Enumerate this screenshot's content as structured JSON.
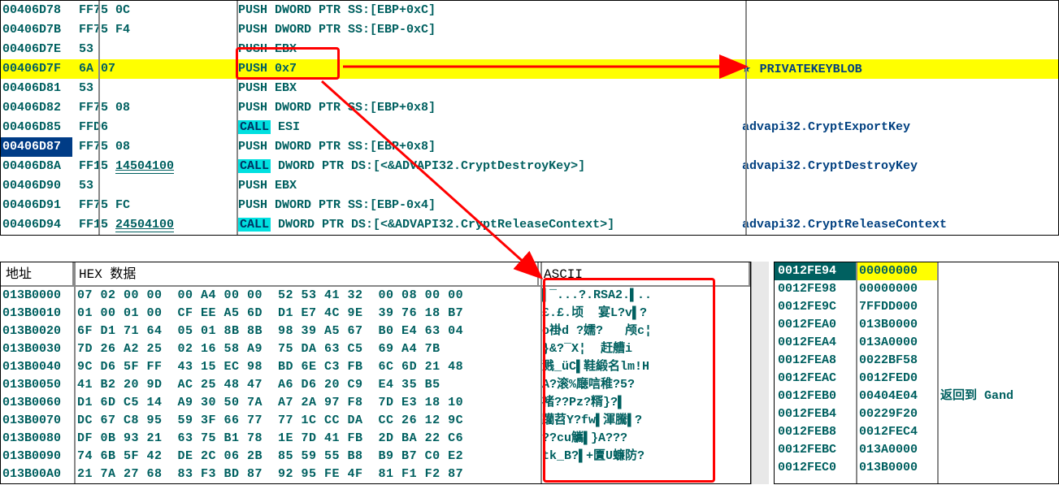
{
  "asm": [
    {
      "addr": "00406D78",
      "bytes": "FF75 0C",
      "op": "PUSH",
      "args": "DWORD PTR SS:[EBP+0xC]",
      "cmt": ""
    },
    {
      "addr": "00406D7B",
      "bytes": "FF75 F4",
      "op": "PUSH",
      "args": "DWORD PTR SS:[EBP-0xC]",
      "cmt": ""
    },
    {
      "addr": "00406D7E",
      "bytes": "53",
      "op": "PUSH",
      "args": "EBX",
      "cmt": ""
    },
    {
      "addr": "00406D7F",
      "bytes": "6A 07",
      "op": "PUSH",
      "args": "0x7",
      "cmt": "PRIVATEKEYBLOB",
      "hl": true
    },
    {
      "addr": "00406D81",
      "bytes": "53",
      "op": "PUSH",
      "args": "EBX",
      "cmt": ""
    },
    {
      "addr": "00406D82",
      "bytes": "FF75 08",
      "op": "PUSH",
      "args": "DWORD PTR SS:[EBP+0x8]",
      "cmt": ""
    },
    {
      "addr": "00406D85",
      "bytes": "FFD6",
      "op": "CALL",
      "args": "ESI",
      "cmt": "advapi32.CryptExportKey",
      "call": true
    },
    {
      "addr": "00406D87",
      "bytes": "FF75 08",
      "op": "PUSH",
      "args": "DWORD PTR SS:[EBP+0x8]",
      "cmt": "",
      "sel": true
    },
    {
      "addr": "00406D8A",
      "bytes": "FF15 ",
      "link": "14504100",
      "op": "CALL",
      "args": "DWORD PTR DS:[<&ADVAPI32.CryptDestroyKey>]",
      "cmt": "advapi32.CryptDestroyKey",
      "call": true
    },
    {
      "addr": "00406D90",
      "bytes": "53",
      "op": "PUSH",
      "args": "EBX",
      "cmt": ""
    },
    {
      "addr": "00406D91",
      "bytes": "FF75 FC",
      "op": "PUSH",
      "args": "DWORD PTR SS:[EBP-0x4]",
      "cmt": ""
    },
    {
      "addr": "00406D94",
      "bytes": "FF15 ",
      "link": "24504100",
      "op": "CALL",
      "args": "DWORD PTR DS:[<&ADVAPI32.CryptReleaseContext>]",
      "cmt": "advapi32.CryptReleaseContext",
      "call": true
    }
  ],
  "hex_header": {
    "addr": "地址",
    "hex": "HEX 数据",
    "ascii": "ASCII"
  },
  "hex": [
    {
      "a": "013B0000",
      "b": "07 02 00 00  00 A4 00 00  52 53 41 32  00 08 00 00",
      "s": "▌¯...?.RSA2.▌.."
    },
    {
      "a": "013B0010",
      "b": "01 00 01 00  CF EE A5 6D  D1 E7 4C 9E  39 76 18 B7",
      "s": "£.£.顷  宴L?v▌?"
    },
    {
      "a": "013B0020",
      "b": "6F D1 71 64  05 01 8B 8B  98 39 A5 67  B0 E4 63 04",
      "s": "o褂d ?嬬?   颅c¦"
    },
    {
      "a": "013B0030",
      "b": "7D 26 A2 25  02 16 58 A9  75 DA 63 C5  69 A4 7B   ",
      "s": "}&?¯X¦  赶艚i"
    },
    {
      "a": "013B0040",
      "b": "9C D6 5F FF  43 15 EC 98  BD 6E C3 FB  6C 6D 21 48",
      "s": "溅_üC▌鞋緞名lm!H"
    },
    {
      "a": "013B0050",
      "b": "41 B2 20 9D  AC 25 48 47  A6 D6 20 C9  E4 35 B5   ",
      "s": "A?滚%廰唁稚?5?"
    },
    {
      "a": "013B0060",
      "b": "D1 6D C5 14  A9 30 50 7A  A7 2A 97 F8  7D E3 18 10",
      "s": "褚??Pz?糈}?▌"
    },
    {
      "a": "013B0070",
      "b": "DC 67 C8 95  59 3F 66 77  77 1C CC DA  CC 26 12 9C",
      "s": "躪苕Y?fw▌渾騰▌?"
    },
    {
      "a": "013B0080",
      "b": "DF 0B 93 21  63 75 B1 78  1E 7D 41 FB  2D BA 22 C6",
      "s": "??cu觿▌}A???"
    },
    {
      "a": "013B0090",
      "b": "74 6B 5F 42  DE 2C 06 2B  85 59 55 B8  B9 B7 C0 E2",
      "s": "tk_B?▌+匵U蠊防?"
    },
    {
      "a": "013B00A0",
      "b": "21 7A 27 68  83 F3 BD 87  92 95 FE 4F  81 F1 F2 87",
      "s": ""
    }
  ],
  "stack": [
    {
      "a": "0012FE94",
      "v": "00000000",
      "hl": true
    },
    {
      "a": "0012FE98",
      "v": "00000000"
    },
    {
      "a": "0012FE9C",
      "v": "7FFDD000"
    },
    {
      "a": "0012FEA0",
      "v": "013B0000"
    },
    {
      "a": "0012FEA4",
      "v": "013A0000"
    },
    {
      "a": "0012FEA8",
      "v": "0022BF58"
    },
    {
      "a": "0012FEAC",
      "v": "0012FED0"
    },
    {
      "a": "0012FEB0",
      "v": "00404E04",
      "c": "返回到 Gand"
    },
    {
      "a": "0012FEB4",
      "v": "00229F20"
    },
    {
      "a": "0012FEB8",
      "v": "0012FEC4"
    },
    {
      "a": "0012FEBC",
      "v": "013A0000"
    },
    {
      "a": "0012FEC0",
      "v": "013B0000"
    }
  ]
}
